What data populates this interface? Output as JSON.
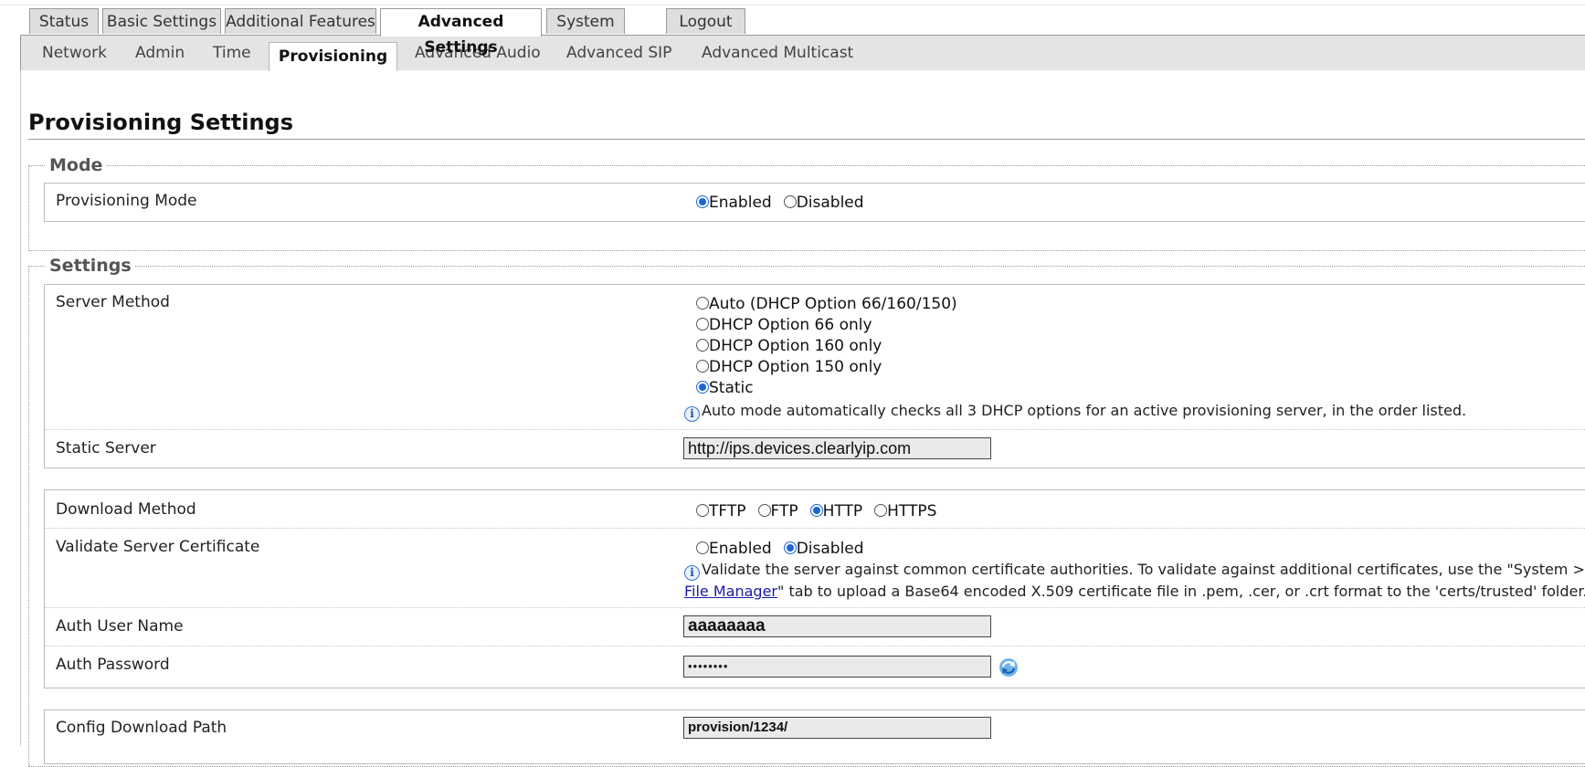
{
  "top_tabs": [
    "Status",
    "Basic Settings",
    "Additional Features",
    "Advanced Settings",
    "System",
    "Logout"
  ],
  "sub_tabs": [
    "Network",
    "Admin",
    "Time",
    "Provisioning",
    "Advanced Audio",
    "Advanced SIP",
    "Advanced Multicast"
  ],
  "page_title": "Provisioning Settings",
  "mode": {
    "legend": "Mode",
    "label": "Provisioning Mode",
    "options": [
      "Enabled",
      "Disabled"
    ],
    "selected": "Enabled"
  },
  "settings": {
    "legend": "Settings",
    "server_method": {
      "label": "Server Method",
      "options": [
        "Auto (DHCP Option 66/160/150)",
        "DHCP Option 66 only",
        "DHCP Option 160 only",
        "DHCP Option 150 only",
        "Static"
      ],
      "selected": "Static",
      "note": "Auto mode automatically checks all 3 DHCP options for an active provisioning server, in the order listed."
    },
    "static_server": {
      "label": "Static Server",
      "value": "http://ips.devices.clearlyip.com"
    },
    "download_method": {
      "label": "Download Method",
      "options": [
        "TFTP",
        "FTP",
        "HTTP",
        "HTTPS"
      ],
      "selected": "HTTP"
    },
    "validate_cert": {
      "label": "Validate Server Certificate",
      "options": [
        "Enabled",
        "Disabled"
      ],
      "selected": "Disabled",
      "note_part1": "Validate the server against common certificate authorities. To validate against additional certificates, use the \"System >",
      "note_link": "File Manager",
      "note_part2": "\" tab to upload a Base64 encoded X.509 certificate file in .pem, .cer, or .crt format to the 'certs/trusted' folder."
    },
    "auth_user": {
      "label": "Auth User Name",
      "value": "aaaaaaaa"
    },
    "auth_password": {
      "label": "Auth Password",
      "value": "••••••••"
    },
    "config_path": {
      "label": "Config Download Path",
      "value": "provision/1234/"
    }
  },
  "icons": {
    "info": "info-icon",
    "refresh": "refresh-icon"
  },
  "colors": {
    "radio_selected": "#1a66d6",
    "link": "#1a1aa8",
    "tab_bg": "#dedede"
  }
}
